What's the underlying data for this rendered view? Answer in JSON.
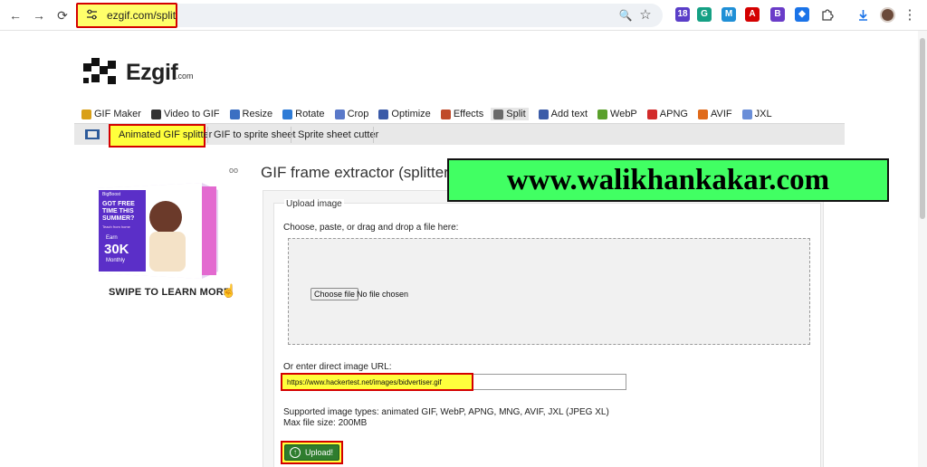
{
  "browser": {
    "url": "ezgif.com/split",
    "back_icon": "←",
    "forward_icon": "→",
    "reload_icon": "⟳",
    "zoom_icon": "🔍",
    "star_icon": "☆",
    "menu_icon": "⋮",
    "extensions": [
      {
        "name": "ext-1",
        "glyph": "18",
        "color": "#5a3ec8"
      },
      {
        "name": "grammarly",
        "glyph": "G",
        "color": "#15a084"
      },
      {
        "name": "ext-m",
        "glyph": "M",
        "color": "#1f8fd6"
      },
      {
        "name": "pdf",
        "glyph": "A",
        "color": "#d40000"
      },
      {
        "name": "ext-b",
        "glyph": "B",
        "color": "#6a3cc8"
      },
      {
        "name": "ext-tag",
        "glyph": "◆",
        "color": "#1a73e8"
      }
    ]
  },
  "site": {
    "logo_text": "Ezgif",
    "logo_suffix": ".com",
    "menu": [
      {
        "label": "GIF Maker",
        "icon_color": "#d9a017"
      },
      {
        "label": "Video to GIF",
        "icon_color": "#333333"
      },
      {
        "label": "Resize",
        "icon_color": "#3b6fc2"
      },
      {
        "label": "Rotate",
        "icon_color": "#2e7bd6"
      },
      {
        "label": "Crop",
        "icon_color": "#5a79c9"
      },
      {
        "label": "Optimize",
        "icon_color": "#3a5aa8"
      },
      {
        "label": "Effects",
        "icon_color": "#c04a2a"
      },
      {
        "label": "Split",
        "icon_color": "#6a6a6a"
      },
      {
        "label": "Add text",
        "icon_color": "#3b5ca8"
      },
      {
        "label": "WebP",
        "icon_color": "#5aa02c"
      },
      {
        "label": "APNG",
        "icon_color": "#d22b2b"
      },
      {
        "label": "AVIF",
        "icon_color": "#e06a1a"
      },
      {
        "label": "JXL",
        "icon_color": "#6a8ed8"
      }
    ],
    "submenu": [
      "Animated GIF splitter",
      "GIF to sprite sheet",
      "Sprite sheet cutter"
    ],
    "ad_swipe": "SWIPE TO LEARN MORE",
    "ad_link": "oo",
    "ad": {
      "brand": "BigBoost",
      "headline": "GOT FREE TIME THIS SUMMER?",
      "subhead": "Teach from home",
      "earn": "Earn",
      "amount": "30K",
      "period": "Monthly"
    }
  },
  "page": {
    "title": "GIF frame extractor (splitter)",
    "banner": "www.walikhankakar.com",
    "upload_legend": "Upload image",
    "drop_label": "Choose, paste, or drag and drop a file here:",
    "choose_button": "Choose file",
    "no_file": "No file chosen",
    "url_label": "Or enter direct image URL:",
    "url_value": "https://www.hackertest.net/images/bidvertiser.gif",
    "supported": "Supported image types: animated GIF, WebP, APNG, MNG, AVIF, JXL (JPEG XL)",
    "max_size": "Max file size: 200MB",
    "upload_button": "Upload!"
  },
  "colors": {
    "highlight": "#ffff3c",
    "highlight_border": "#d40000",
    "banner_bg": "#41ff63",
    "upload_bg": "#2e7d2e"
  }
}
